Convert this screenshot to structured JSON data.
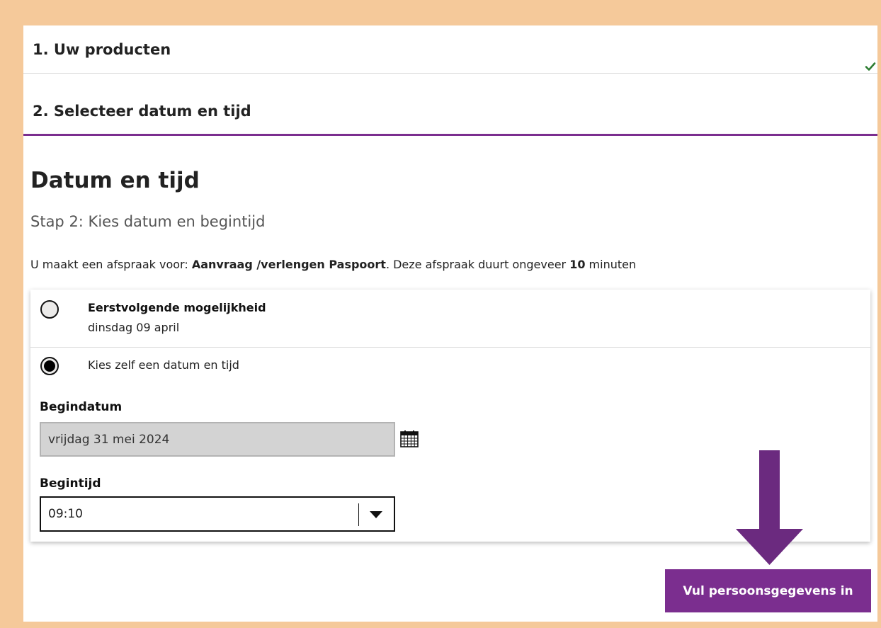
{
  "steps": {
    "step1_title": "1. Uw producten",
    "step1_complete_icon": "check-icon",
    "step2_title": "2. Selecteer datum en tijd"
  },
  "main": {
    "title": "Datum en tijd",
    "subtitle": "Stap 2: Kies datum en begintijd",
    "info": {
      "prefix": "U maakt een afspraak voor: ",
      "product": "Aanvraag /verlengen Paspoort",
      "middle": ". Deze afspraak duurt ongeveer ",
      "duration": "10",
      "suffix": " minuten"
    }
  },
  "options": {
    "first": {
      "title": "Eerstvolgende mogelijkheid",
      "date": "dinsdag 09 april",
      "selected": false
    },
    "second": {
      "label": "Kies zelf een datum en tijd",
      "selected": true
    }
  },
  "form": {
    "start_date_label": "Begindatum",
    "start_date_value": "vrijdag 31 mei 2024",
    "calendar_icon": "calendar-icon",
    "start_time_label": "Begintijd",
    "start_time_value": "09:10",
    "dropdown_icon": "chevron-down-icon"
  },
  "cta": {
    "label": "Vul persoonsgegevens in",
    "pointer_icon": "arrow-down-icon"
  },
  "colors": {
    "accent": "#7b2e8f",
    "frame": "#f5c99a",
    "success": "#2e7d32"
  }
}
